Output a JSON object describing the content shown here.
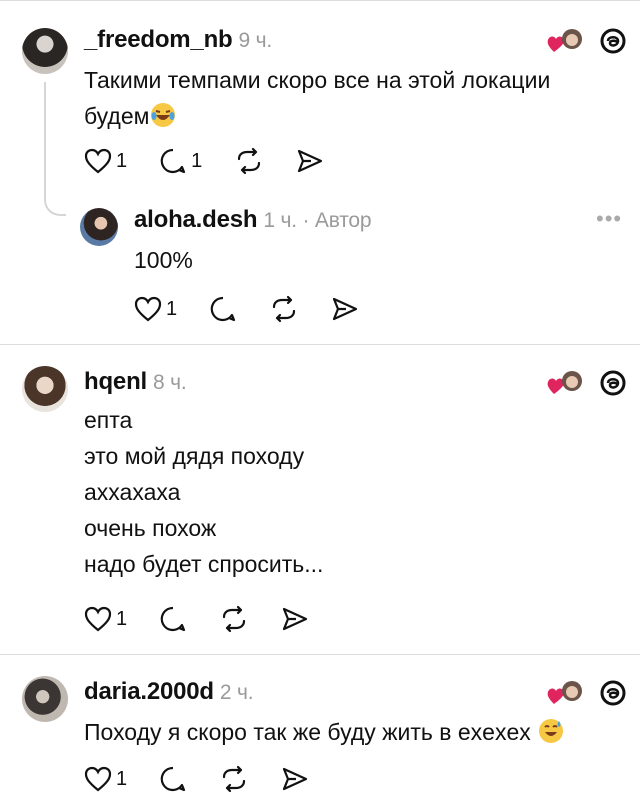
{
  "comments": [
    {
      "username": "_freedom_nb",
      "time": "9 ч.",
      "lines": [
        "Такими темпами скоро все на этой локации",
        "будем"
      ],
      "likes": "1",
      "replies": "1"
    },
    {
      "username": "aloha.desh",
      "time": "1 ч. · Автор",
      "lines": [
        "100%"
      ],
      "likes": "1"
    },
    {
      "username": "hqenl",
      "time": "8 ч.",
      "lines": [
        "епта",
        "это мой дядя походу",
        "аххахаха",
        "очень похож",
        "надо будет спросить..."
      ],
      "likes": "1"
    },
    {
      "username": "daria.2000d",
      "time": "2 ч.",
      "lines": [
        "Походу я скоро так же буду жить в exexex"
      ],
      "likes": "1"
    }
  ],
  "icons": {
    "heart": "heart-icon",
    "comment": "comment-icon",
    "repost": "repost-icon",
    "share": "share-icon",
    "threads": "threads-logo-icon",
    "reaction": "liked-by-author-icon",
    "more": "more-options-icon"
  },
  "colors": {
    "like_red": "#e0245e",
    "meta_gray": "#9a9a9a",
    "divider": "#dcdcdc"
  }
}
